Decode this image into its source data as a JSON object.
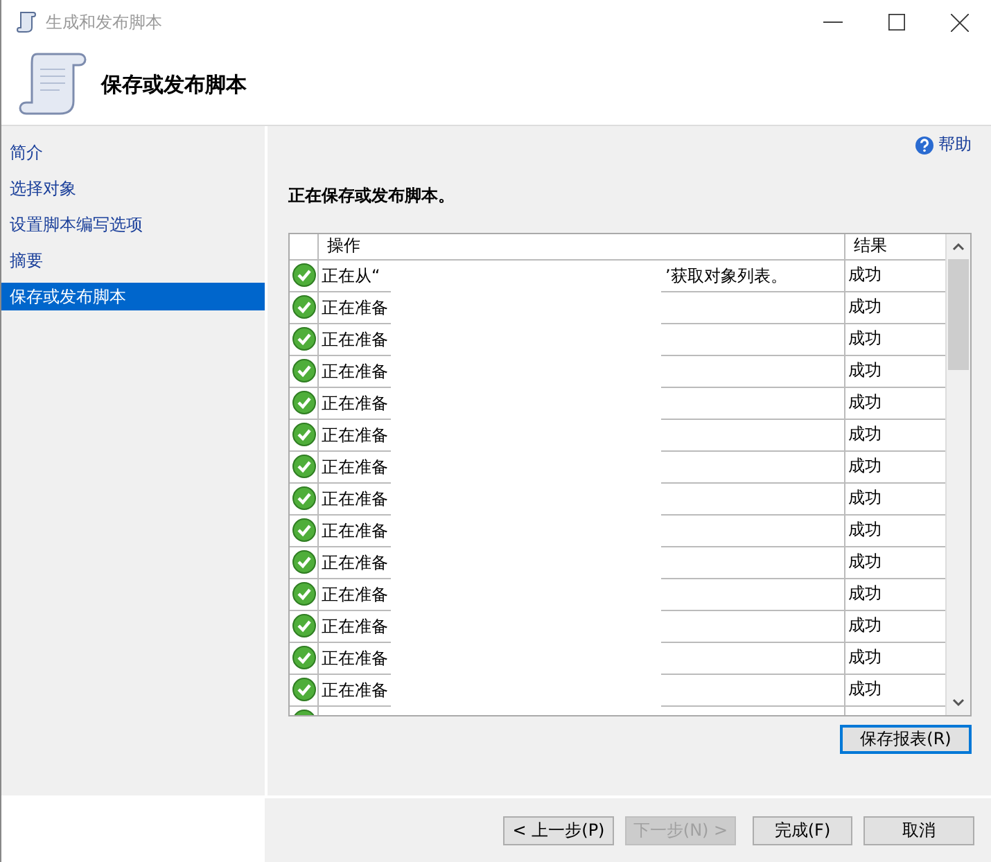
{
  "window": {
    "title": "生成和发布脚本"
  },
  "header": {
    "title": "保存或发布脚本"
  },
  "sidebar": {
    "items": [
      {
        "label": "简介",
        "selected": false
      },
      {
        "label": "选择对象",
        "selected": false
      },
      {
        "label": "设置脚本编写选项",
        "selected": false
      },
      {
        "label": "摘要",
        "selected": false
      },
      {
        "label": "保存或发布脚本",
        "selected": true
      }
    ]
  },
  "help": "帮助",
  "heading": "正在保存或发布脚本。",
  "table": {
    "columns": [
      "操作",
      "结果"
    ],
    "rows": [
      {
        "operation": "正在从“",
        "operation_tail": "’获取对象列表。",
        "result": "成功"
      },
      {
        "operation": "正在准备",
        "result": "成功"
      },
      {
        "operation": "正在准备",
        "result": "成功"
      },
      {
        "operation": "正在准备",
        "result": "成功"
      },
      {
        "operation": "正在准备",
        "result": "成功"
      },
      {
        "operation": "正在准备",
        "result": "成功"
      },
      {
        "operation": "正在准备",
        "result": "成功"
      },
      {
        "operation": "正在准备",
        "result": "成功"
      },
      {
        "operation": "正在准备",
        "result": "成功"
      },
      {
        "operation": "正在准备",
        "result": "成功"
      },
      {
        "operation": "正在准备",
        "result": "成功"
      },
      {
        "operation": "正在准备",
        "result": "成功"
      },
      {
        "operation": "正在准备",
        "result": "成功"
      },
      {
        "operation": "正在准备",
        "result": "成功"
      }
    ]
  },
  "save_report": "保存报表(R)",
  "buttons": [
    {
      "label": "< 上一步(P)",
      "disabled": false
    },
    {
      "label": "下一步(N) >",
      "disabled": true
    },
    {
      "label": "完成(F)",
      "disabled": false
    },
    {
      "label": "取消",
      "disabled": false
    }
  ]
}
